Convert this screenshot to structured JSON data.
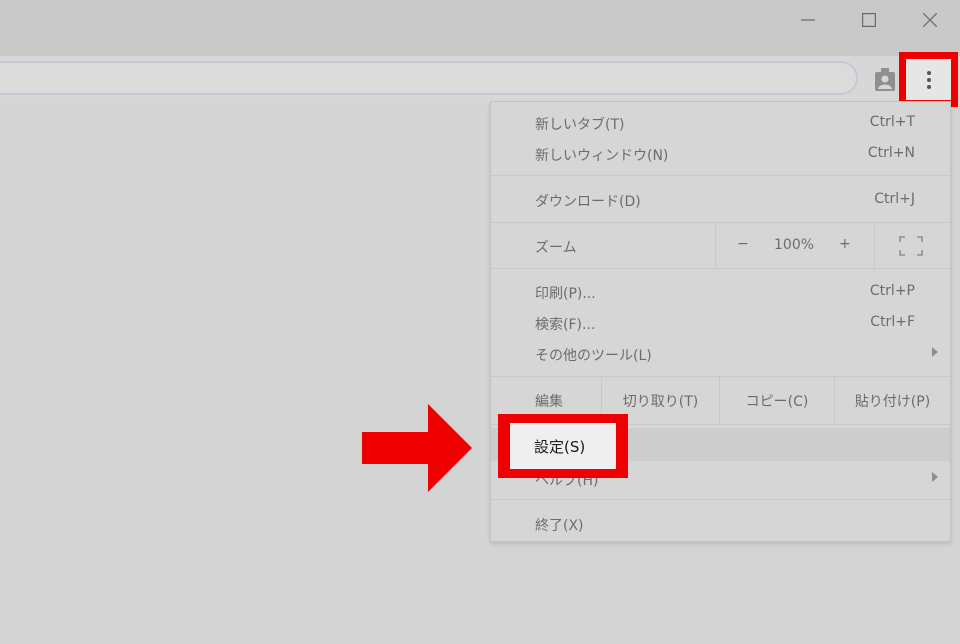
{
  "window": {
    "minimize_icon": "minimize-icon",
    "maximize_icon": "maximize-icon",
    "close_icon": "close-icon"
  },
  "toolbar": {
    "profile_icon": "profile-icon",
    "menu_icon": "kebab-menu-icon"
  },
  "menu": {
    "new_tab": {
      "label": "新しいタブ(T)",
      "shortcut": "Ctrl+T"
    },
    "new_window": {
      "label": "新しいウィンドウ(N)",
      "shortcut": "Ctrl+N"
    },
    "downloads": {
      "label": "ダウンロード(D)",
      "shortcut": "Ctrl+J"
    },
    "zoom": {
      "label": "ズーム",
      "minus": "−",
      "value": "100%",
      "plus": "+"
    },
    "print": {
      "label": "印刷(P)...",
      "shortcut": "Ctrl+P"
    },
    "find": {
      "label": "検索(F)...",
      "shortcut": "Ctrl+F"
    },
    "more_tools": {
      "label": "その他のツール(L)"
    },
    "edit": {
      "label": "編集",
      "cut": "切り取り(T)",
      "copy": "コピー(C)",
      "paste": "貼り付け(P)"
    },
    "settings": {
      "label": "設定(S)"
    },
    "help": {
      "label": "ヘルプ(H)"
    },
    "exit": {
      "label": "終了(X)"
    }
  },
  "annotations": {
    "highlight_color": "#ee0000"
  }
}
